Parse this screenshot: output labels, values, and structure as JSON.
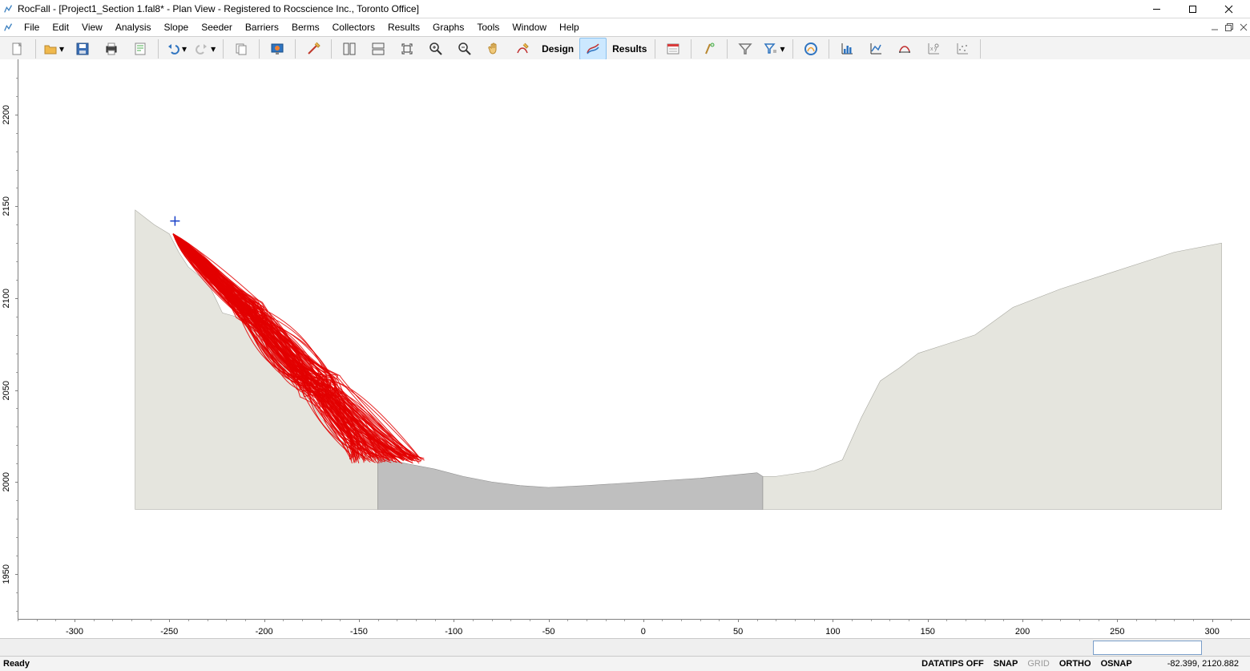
{
  "window": {
    "title": "RocFall - [Project1_Section 1.fal8* - Plan View - Registered to Rocscience Inc., Toronto Office]"
  },
  "menu": {
    "items": [
      "File",
      "Edit",
      "View",
      "Analysis",
      "Slope",
      "Seeder",
      "Barriers",
      "Berms",
      "Collectors",
      "Results",
      "Graphs",
      "Tools",
      "Window",
      "Help"
    ]
  },
  "toolbar": {
    "design_label": "Design",
    "results_label": "Results"
  },
  "axes": {
    "y_ticks": [
      1950,
      2000,
      2050,
      2100,
      2150,
      2200
    ],
    "x_ticks": [
      -300,
      -250,
      -200,
      -150,
      -100,
      -50,
      0,
      50,
      100,
      150,
      200,
      250,
      300
    ]
  },
  "status": {
    "ready": "Ready",
    "datatips": "DATATIPS OFF",
    "snap": "SNAP",
    "grid": "GRID",
    "ortho": "ORTHO",
    "osnap": "OSNAP",
    "coords": "-82.399, 2120.882"
  },
  "prompt": {
    "value": ""
  },
  "chart_data": {
    "type": "line",
    "title": "",
    "xlabel": "",
    "ylabel": "",
    "xlim": [
      -330,
      320
    ],
    "ylim": [
      1925,
      2230
    ],
    "series": [
      {
        "name": "slope-profile",
        "x": [
          -268,
          -258,
          -250,
          -245,
          -240,
          -234,
          -228,
          -222,
          -215,
          -208,
          -200,
          -194,
          -188,
          -178,
          -170,
          -160,
          -150,
          -140,
          -125,
          -110,
          -95,
          -80,
          -65,
          -50,
          -30,
          0,
          30,
          60,
          63,
          70,
          90,
          105,
          115,
          125,
          135,
          145,
          160,
          175,
          195,
          220,
          250,
          280,
          305
        ],
        "y": [
          2148,
          2140,
          2135,
          2125,
          2117,
          2112,
          2105,
          2092,
          2090,
          2088,
          2078,
          2070,
          2060,
          2048,
          2035,
          2023,
          2015,
          2013,
          2010,
          2007,
          2003,
          2000,
          1998,
          1997,
          1998,
          2000,
          2002,
          2005,
          2003,
          2003,
          2006,
          2012,
          2035,
          2055,
          2062,
          2070,
          2075,
          2080,
          2095,
          2105,
          2115,
          2125,
          2130
        ]
      },
      {
        "name": "seeder-cross",
        "x": [
          -247
        ],
        "y": [
          2142
        ]
      },
      {
        "name": "rock-path-envelope",
        "note": "bounding points of red trajectory cloud",
        "x": [
          -248,
          -240,
          -232,
          -225,
          -215,
          -210,
          -200,
          -190,
          -180,
          -170,
          -160,
          -150,
          -140,
          -130,
          -120,
          -130,
          -145,
          -160,
          -175,
          -190,
          -205,
          -218,
          -228,
          -238,
          -246
        ],
        "y": [
          2135,
          2120,
          2108,
          2098,
          2092,
          2095,
          2095,
          2090,
          2078,
          2062,
          2045,
          2030,
          2016,
          2012,
          2010,
          2010,
          2010,
          2012,
          2016,
          2028,
          2050,
          2070,
          2090,
          2110,
          2128
        ]
      }
    ]
  }
}
